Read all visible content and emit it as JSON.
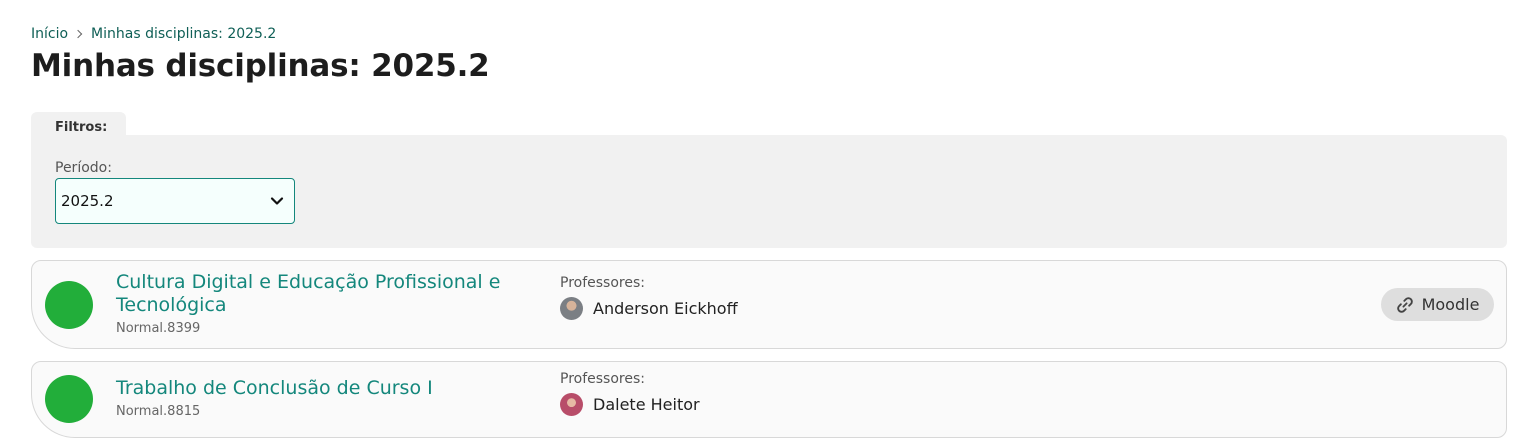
{
  "breadcrumb": {
    "home": "Início",
    "current": "Minhas disciplinas: 2025.2"
  },
  "page": {
    "title": "Minhas disciplinas: 2025.2"
  },
  "filters": {
    "tab_label": "Filtros:",
    "period_label": "Período:",
    "period_selected": "2025.2"
  },
  "courses": [
    {
      "name": "Cultura Digital e Educação Profissional e Tecnológica",
      "code": "Normal.8399",
      "teachers_label": "Professores:",
      "teacher": "Anderson Eickhoff",
      "link_label": "Moodle",
      "status_color": "#22ae3a"
    },
    {
      "name": "Trabalho de Conclusão de Curso I",
      "code": "Normal.8815",
      "teachers_label": "Professores:",
      "teacher": "Dalete Heitor",
      "status_color": "#22ae3a"
    }
  ],
  "icons": {
    "breadcrumb_separator": "chevron-right-icon",
    "select": "chevron-down-icon",
    "moodle": "link-icon"
  },
  "colors": {
    "link": "#14877c",
    "breadcrumb": "#0f5f56",
    "panel": "#f1f1f1"
  }
}
